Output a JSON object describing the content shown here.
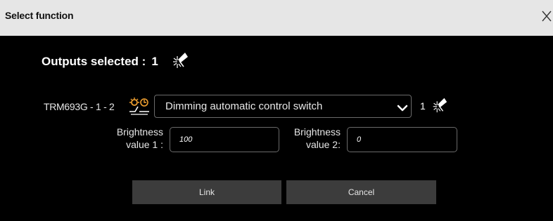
{
  "dialog": {
    "title": "Select function",
    "close_icon": "close-icon"
  },
  "outputs": {
    "label": "Outputs selected :",
    "count": "1",
    "icon": "light-bulb-icon"
  },
  "device": {
    "name": "TRM693G - 1 - 2",
    "icon": "sensor-switch-icon"
  },
  "function_select": {
    "value": "Dimming automatic control switch",
    "icon": "chevron-down-icon"
  },
  "selected_count": {
    "count": "1",
    "icon": "light-bulb-icon"
  },
  "brightness1": {
    "label_line1": "Brightness",
    "label_line2": "value 1 :",
    "value": "100"
  },
  "brightness2": {
    "label_line1": "Brightness",
    "label_line2": "value 2:",
    "value": "0"
  },
  "buttons": {
    "link": "Link",
    "cancel": "Cancel"
  },
  "colors": {
    "title_bar": "#e6e6e6",
    "content_bg": "#000000",
    "button_bg": "#3c3c3c",
    "border": "#6a6a6a"
  }
}
